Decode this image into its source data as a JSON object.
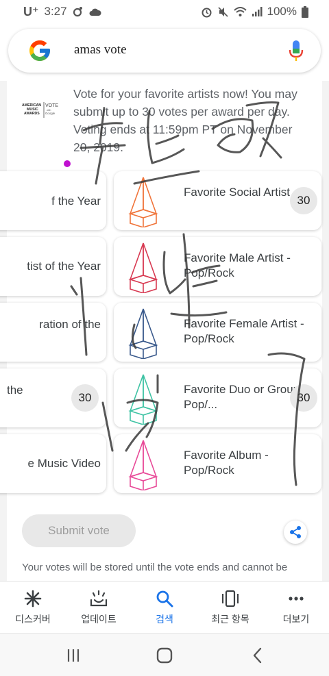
{
  "status_bar": {
    "carrier": "U⁺",
    "time": "3:27",
    "battery": "100%"
  },
  "search": {
    "query": "amas vote"
  },
  "intro": {
    "logo_lines": [
      "AMERICAN",
      "MUSIC",
      "AWARDS"
    ],
    "logo_vote": "VOTE",
    "logo_with": "with",
    "logo_google": "Google",
    "text": "Vote for your favorite artists now! You may submit up to 30 votes per award per day. Voting ends at 11:59pm PT on November 20, 2019."
  },
  "left_categories": [
    {
      "label": "f the Year"
    },
    {
      "label": "tist of the Year"
    },
    {
      "label": "ration of the"
    },
    {
      "label": "the",
      "count": "30"
    },
    {
      "label": "e Music Video"
    }
  ],
  "right_categories": [
    {
      "label": "Favorite Social Artist",
      "count": "30",
      "trophy_color": "#f0743a"
    },
    {
      "label": "Favorite Male Artist - Pop/Rock",
      "trophy_color": "#d83a52"
    },
    {
      "label": "Favorite Female Artist - Pop/Rock",
      "trophy_color": "#3a5a8c"
    },
    {
      "label": "Favorite Duo or Group - Pop/...",
      "count": "30",
      "trophy_color": "#3fc3a4"
    },
    {
      "label": "Favorite Album - Pop/Rock",
      "trophy_color": "#e84a98"
    }
  ],
  "actions": {
    "submit_label": "Submit vote",
    "footnote": "Your votes will be stored until the vote ends and cannot be"
  },
  "bottom_nav": [
    {
      "label": "디스커버",
      "icon": "discover-icon"
    },
    {
      "label": "업데이트",
      "icon": "updates-icon"
    },
    {
      "label": "검색",
      "icon": "search-icon",
      "active": true
    },
    {
      "label": "최근 항목",
      "icon": "recent-icon"
    },
    {
      "label": "더보기",
      "icon": "more-icon"
    }
  ],
  "colors": {
    "accent": "#1a73e8",
    "text_gray": "#5f6368",
    "badge_bg": "#e8e8e8"
  }
}
